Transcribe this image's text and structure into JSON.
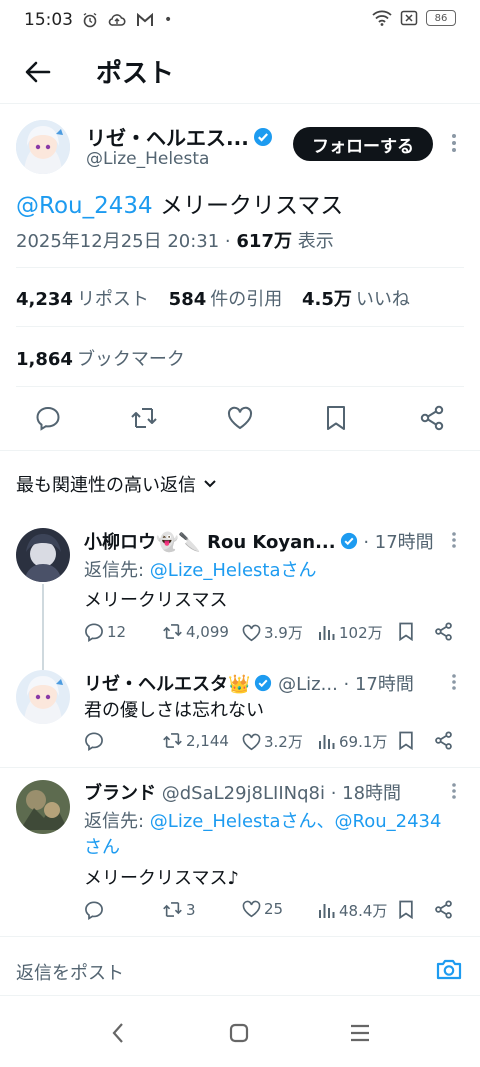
{
  "status_bar": {
    "time": "15:03",
    "dot": "•",
    "battery": "86"
  },
  "header": {
    "title": "ポスト"
  },
  "post": {
    "author_name": "リゼ・ヘルエス...",
    "author_handle": "@Lize_Helesta",
    "follow_label": "フォローする",
    "mention": "@Rou_2434",
    "text": " メリークリスマス",
    "date": "2025年12月25日 20:31 · ",
    "views_count": "617万",
    "views_label": " 表示",
    "reposts_count": "4,234",
    "reposts_label": "リポスト",
    "quotes_count": "584",
    "quotes_label": "件の引用",
    "likes_count": "4.5万",
    "likes_label": "いいね",
    "bookmarks_count": "1,864",
    "bookmarks_label": "ブックマーク"
  },
  "sort": {
    "label": "最も関連性の高い返信"
  },
  "replies": [
    {
      "name": "小柳ロウ👻🔪 Rou Koyan...",
      "meta": " · 17時間",
      "reply_prefix": "返信先: ",
      "reply_to": "@Lize_Helestaさん",
      "text": "メリークリスマス",
      "replies": "12",
      "reposts": "4,099",
      "likes": "3.9万",
      "views": "102万"
    },
    {
      "name": "リゼ・ヘルエスタ👑",
      "meta": " @Liz... · 17時間",
      "text": "君の優しさは忘れない",
      "replies": "",
      "reposts": "2,144",
      "likes": "3.2万",
      "views": "69.1万"
    },
    {
      "name": "ブランド",
      "meta": " @dSaL29j8LIINq8i · 18時間",
      "reply_prefix": "返信先: ",
      "reply_to": "@Lize_Helestaさん、@Rou_2434",
      "reply_to_2": "さん",
      "text": "メリークリスマス♪",
      "replies": "",
      "reposts": "3",
      "likes": "25",
      "views": "48.4万"
    }
  ],
  "reply_box": {
    "placeholder": "返信をポスト"
  },
  "colors": {
    "accent": "#1d9bf0",
    "text": "#0f1419",
    "muted": "#536471"
  }
}
